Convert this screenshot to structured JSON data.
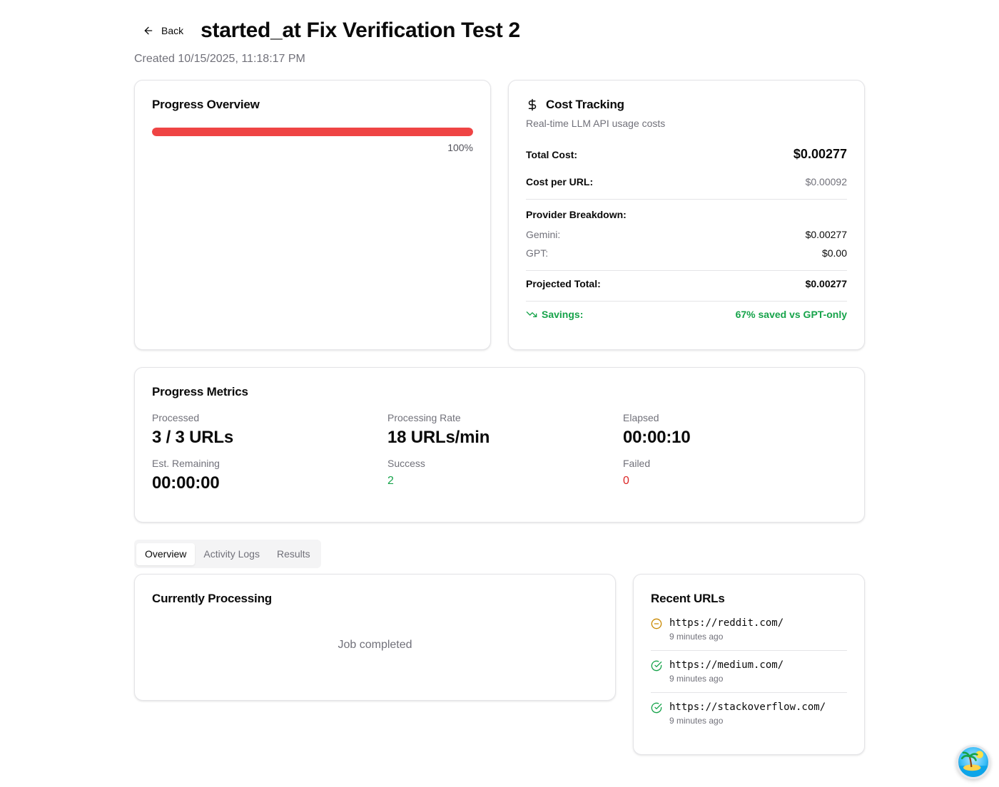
{
  "header": {
    "back_label": "Back",
    "title": "started_at Fix Verification Test 2",
    "created": "Created 10/15/2025, 11:18:17 PM"
  },
  "progress_overview": {
    "title": "Progress Overview",
    "percent": 100,
    "percent_label": "100%",
    "bar_color": "#ef4444"
  },
  "cost_tracking": {
    "title": "Cost Tracking",
    "subtitle": "Real-time LLM API usage costs",
    "total_label": "Total Cost:",
    "total_value": "$0.00277",
    "per_url_label": "Cost per URL:",
    "per_url_value": "$0.00092",
    "breakdown_title": "Provider Breakdown:",
    "providers": [
      {
        "label": "Gemini:",
        "value": "$0.00277"
      },
      {
        "label": "GPT:",
        "value": "$0.00"
      }
    ],
    "projected_label": "Projected Total:",
    "projected_value": "$0.00277",
    "savings_label": "Savings:",
    "savings_value": "67% saved vs GPT-only",
    "savings_color": "#16a34a"
  },
  "metrics": {
    "title": "Progress Metrics",
    "processed_label": "Processed",
    "processed_value": "3 / 3 URLs",
    "rate_label": "Processing Rate",
    "rate_value": "18 URLs/min",
    "elapsed_label": "Elapsed",
    "elapsed_value": "00:00:10",
    "remaining_label": "Est. Remaining",
    "remaining_value": "00:00:00",
    "success_label": "Success",
    "success_value": "2",
    "failed_label": "Failed",
    "failed_value": "0"
  },
  "tabs": [
    {
      "label": "Overview",
      "active": true
    },
    {
      "label": "Activity Logs",
      "active": false
    },
    {
      "label": "Results",
      "active": false
    }
  ],
  "current": {
    "title": "Currently Processing",
    "status": "Job completed"
  },
  "recent": {
    "title": "Recent URLs",
    "items": [
      {
        "url": "https://reddit.com/",
        "time": "9 minutes ago",
        "status": "skipped",
        "icon": "minus-circle-icon"
      },
      {
        "url": "https://medium.com/",
        "time": "9 minutes ago",
        "status": "success",
        "icon": "check-circle-icon"
      },
      {
        "url": "https://stackoverflow.com/",
        "time": "9 minutes ago",
        "status": "success",
        "icon": "check-circle-icon"
      }
    ]
  }
}
